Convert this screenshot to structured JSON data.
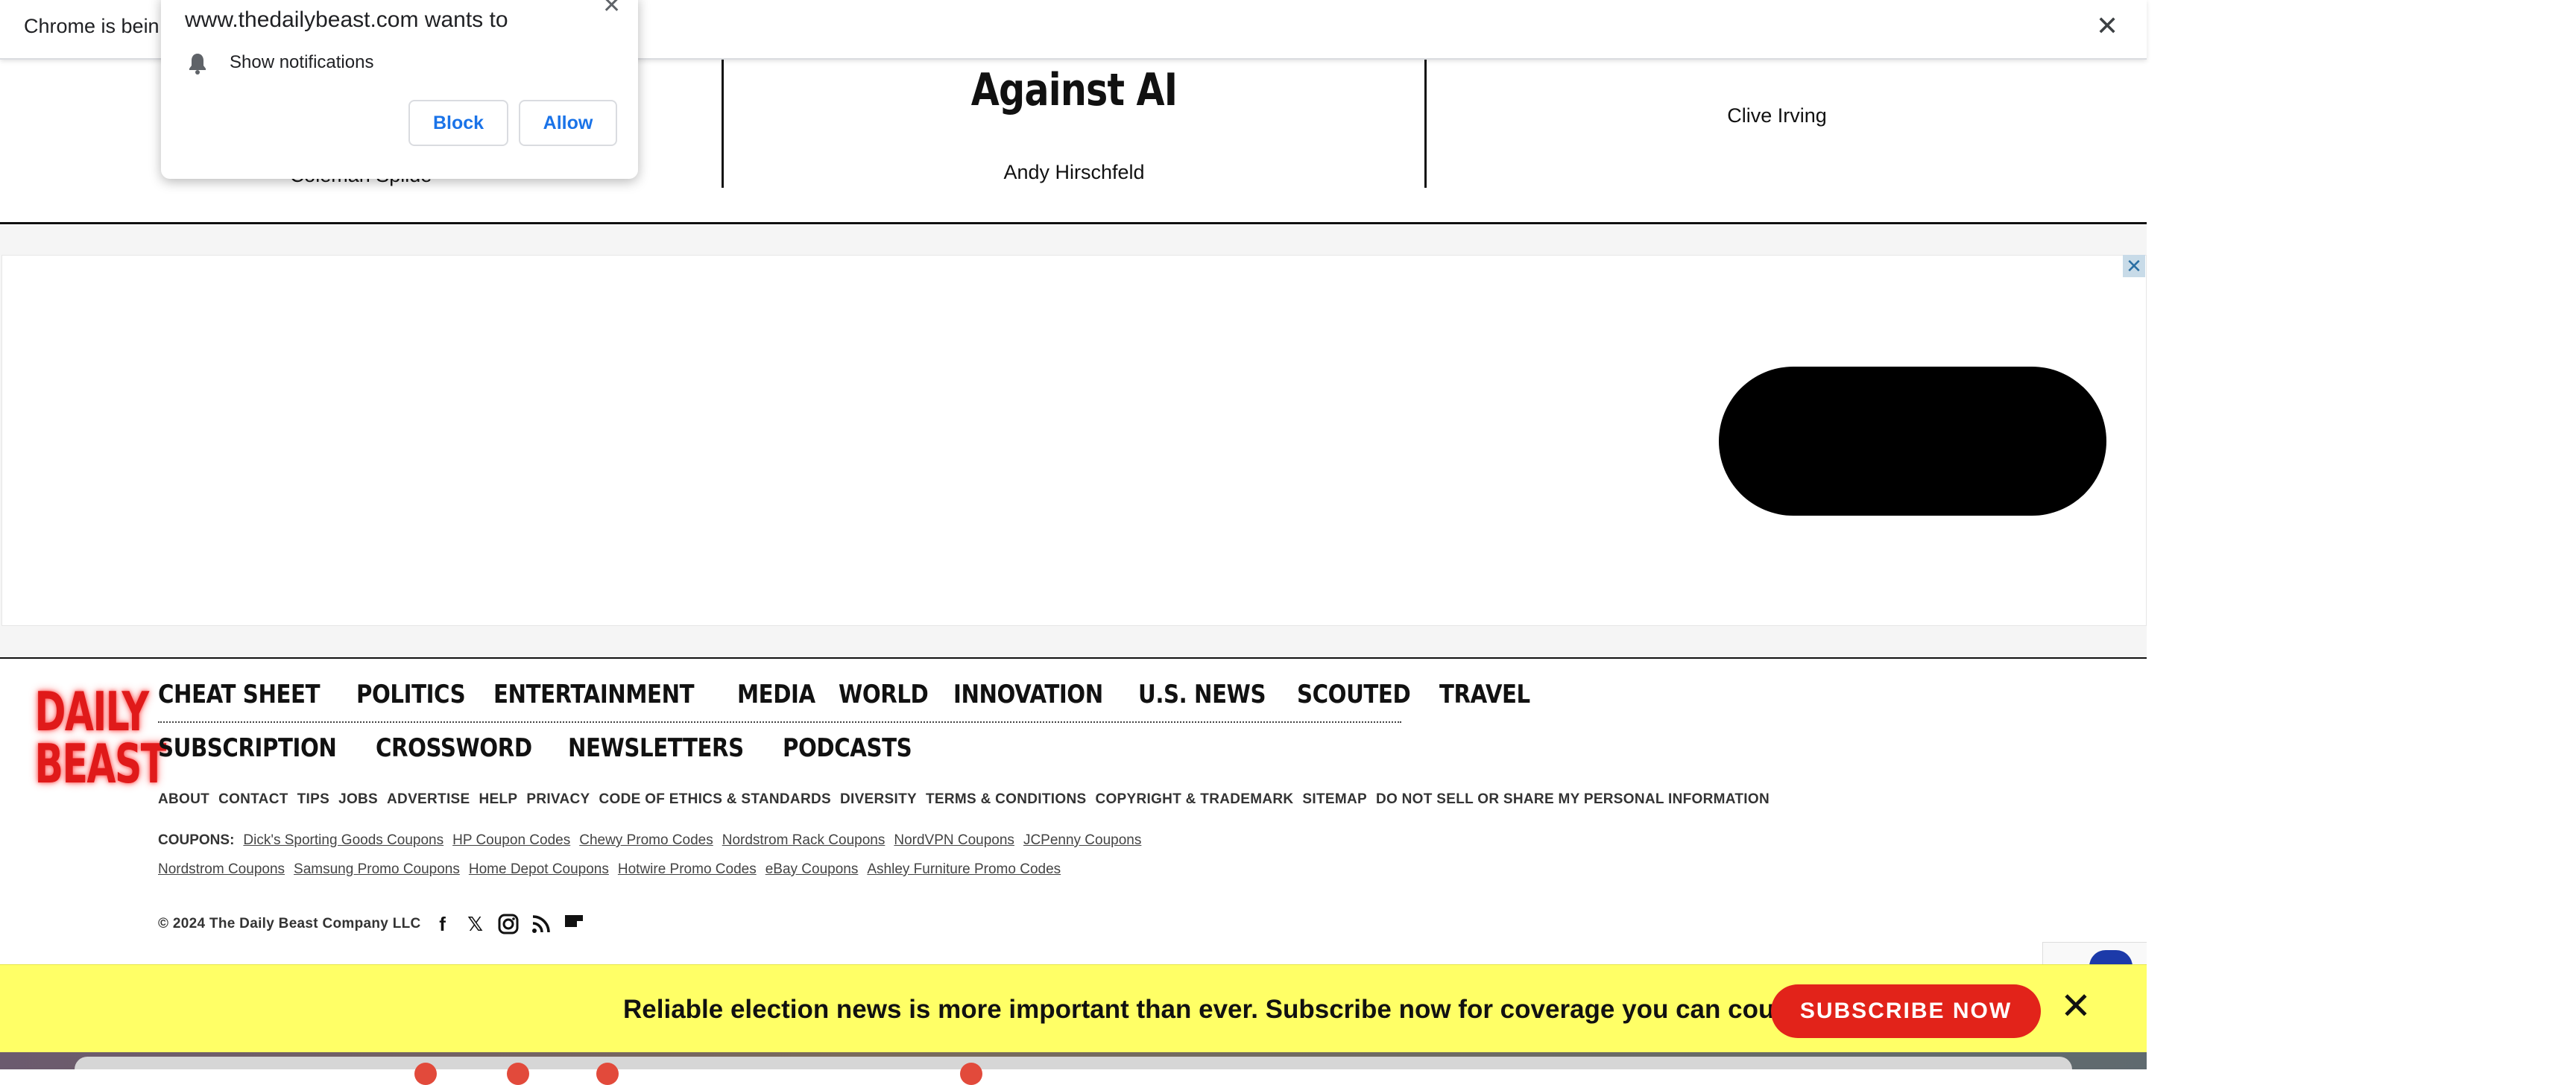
{
  "chrome_infobar": {
    "text": "Chrome is bein"
  },
  "notification_prompt": {
    "title": "www.thedailybeast.com wants to",
    "permission": "Show notifications",
    "block_label": "Block",
    "allow_label": "Allow"
  },
  "articles": [
    {
      "headline": "",
      "author": "Coleman Spilde"
    },
    {
      "headline": "Against AI",
      "author": "Andy Hirschfeld"
    },
    {
      "headline": "",
      "author": "Clive Irving"
    }
  ],
  "footer": {
    "logo": {
      "line1": "DAILY",
      "line2": "BEAST"
    },
    "nav_primary": [
      "CHEAT SHEET",
      "POLITICS",
      "ENTERTAINMENT",
      "MEDIA",
      "WORLD",
      "INNOVATION",
      "U.S. NEWS",
      "SCOUTED",
      "TRAVEL"
    ],
    "nav_secondary": [
      "SUBSCRIPTION",
      "CROSSWORD",
      "NEWSLETTERS",
      "PODCASTS"
    ],
    "utility_links": [
      "ABOUT",
      "CONTACT",
      "TIPS",
      "JOBS",
      "ADVERTISE",
      "HELP",
      "PRIVACY",
      "CODE OF ETHICS & STANDARDS",
      "DIVERSITY",
      "TERMS & CONDITIONS",
      "COPYRIGHT & TRADEMARK",
      "SITEMAP",
      "DO NOT SELL OR SHARE MY PERSONAL INFORMATION"
    ],
    "coupons_label": "COUPONS:",
    "coupons_row1": [
      "Dick's Sporting Goods Coupons",
      "HP Coupon Codes",
      "Chewy Promo Codes",
      "Nordstrom Rack Coupons",
      "NordVPN Coupons",
      "JCPenny Coupons"
    ],
    "coupons_row2": [
      "Nordstrom Coupons",
      "Samsung Promo Coupons",
      "Home Depot Coupons",
      "Hotwire Promo Codes",
      "eBay Coupons",
      "Ashley Furniture Promo Codes"
    ],
    "copyright": "© 2024 The Daily Beast Company LLC",
    "social_icons": [
      "facebook-icon",
      "x-icon",
      "instagram-icon",
      "rss-icon",
      "flipboard-icon"
    ]
  },
  "promo_banner": {
    "text": "Reliable election news is more important than ever. Subscribe now for coverage you can count on.",
    "button": "SUBSCRIBE NOW"
  },
  "colors": {
    "brand_red": "#e2231a",
    "banner_yellow": "#ffff66",
    "chrome_blue": "#1a73e8"
  }
}
